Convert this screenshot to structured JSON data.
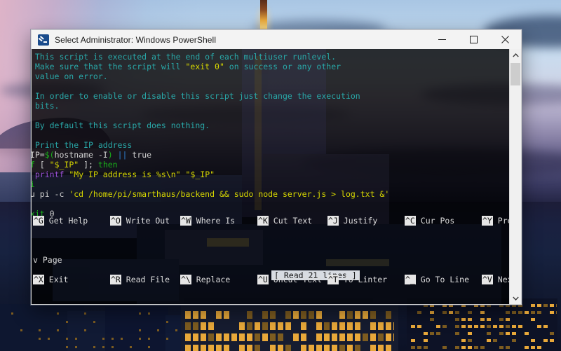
{
  "window": {
    "title": "Select Administrator: Windows PowerShell",
    "icon": "powershell-icon",
    "minimize_label": "—",
    "maximize_label": "□",
    "close_label": "✕"
  },
  "terminal": {
    "editor": "nano",
    "status_message": "[ Read 21 lines ]",
    "lines": [
      [
        {
          "t": "# This script is executed at the end of each multiuser runlevel.",
          "c": "cy"
        }
      ],
      [
        {
          "t": "# Make sure that the script will ",
          "c": "cy"
        },
        {
          "t": "\"exit 0\"",
          "c": "ye"
        },
        {
          "t": " on success or any other",
          "c": "cy"
        }
      ],
      [
        {
          "t": "# value on error.",
          "c": "cy"
        }
      ],
      [
        {
          "t": "#",
          "c": "cy"
        }
      ],
      [
        {
          "t": "# In order to enable or disable this script just change the execution",
          "c": "cy"
        }
      ],
      [
        {
          "t": "# bits.",
          "c": "cy"
        }
      ],
      [
        {
          "t": "#",
          "c": "cy"
        }
      ],
      [
        {
          "t": "# By default this script does nothing.",
          "c": "cy"
        }
      ],
      [
        {
          "t": "",
          "c": "wh"
        }
      ],
      [
        {
          "t": "# Print the IP address",
          "c": "cy"
        }
      ],
      [
        {
          "t": "_IP=",
          "c": "wh"
        },
        {
          "t": "$(",
          "c": "gr"
        },
        {
          "t": "hostname -I",
          "c": "wh"
        },
        {
          "t": ")",
          "c": "gr"
        },
        {
          "t": " ",
          "c": "wh"
        },
        {
          "t": "||",
          "c": "bl"
        },
        {
          "t": " true",
          "c": "wh"
        }
      ],
      [
        {
          "t": "if",
          "c": "gr"
        },
        {
          "t": " [ ",
          "c": "wh"
        },
        {
          "t": "\"$_IP\"",
          "c": "ye"
        },
        {
          "t": " ]; ",
          "c": "wh"
        },
        {
          "t": "then",
          "c": "gr"
        }
      ],
      [
        {
          "t": "  ",
          "c": "wh"
        },
        {
          "t": "printf",
          "c": "ma"
        },
        {
          "t": " ",
          "c": "wh"
        },
        {
          "t": "\"My IP address is %s\\n\"",
          "c": "ye"
        },
        {
          "t": " ",
          "c": "wh"
        },
        {
          "t": "\"$_IP\"",
          "c": "ye"
        }
      ],
      [
        {
          "t": "fi",
          "c": "gr"
        }
      ],
      [
        {
          "t": "su pi -c ",
          "c": "wh"
        },
        {
          "t": "'cd /home/pi/smarthaus/backend && sudo node server.js > log.txt &'",
          "c": "ye"
        }
      ],
      [
        {
          "t": "",
          "c": "wh"
        }
      ],
      [
        {
          "t": "exit",
          "c": "gr"
        },
        {
          "t": " ",
          "c": "wh"
        },
        {
          "t": "0",
          "c": "wh"
        }
      ]
    ],
    "shortcuts_row1": [
      {
        "key": "^G",
        "label": "Get Help"
      },
      {
        "key": "^O",
        "label": "Write Out"
      },
      {
        "key": "^W",
        "label": "Where Is"
      },
      {
        "key": "^K",
        "label": "Cut Text"
      },
      {
        "key": "^J",
        "label": "Justify"
      },
      {
        "key": "^C",
        "label": "Cur Pos"
      },
      {
        "key": "^Y",
        "label": "Pre"
      }
    ],
    "shortcuts_wrap": "v Page",
    "shortcuts_row2": [
      {
        "key": "^X",
        "label": "Exit"
      },
      {
        "key": "^R",
        "label": "Read File"
      },
      {
        "key": "^\\",
        "label": "Replace"
      },
      {
        "key": "^U",
        "label": "Uncut Text"
      },
      {
        "key": "^T",
        "label": "To Linter"
      },
      {
        "key": "^_",
        "label": "Go To Line"
      },
      {
        "key": "^V",
        "label": "Nex"
      }
    ]
  },
  "scrollbar": {
    "up_arrow": "⌃",
    "down_arrow": "⌄"
  },
  "colors": {
    "comment": "#29a8a8",
    "keyword": "#19b219",
    "string": "#d7d700",
    "builtin": "#9a4fd4",
    "titlebar_bg": "#f3f3f3",
    "nano_key_bg": "#e6e6e6"
  }
}
